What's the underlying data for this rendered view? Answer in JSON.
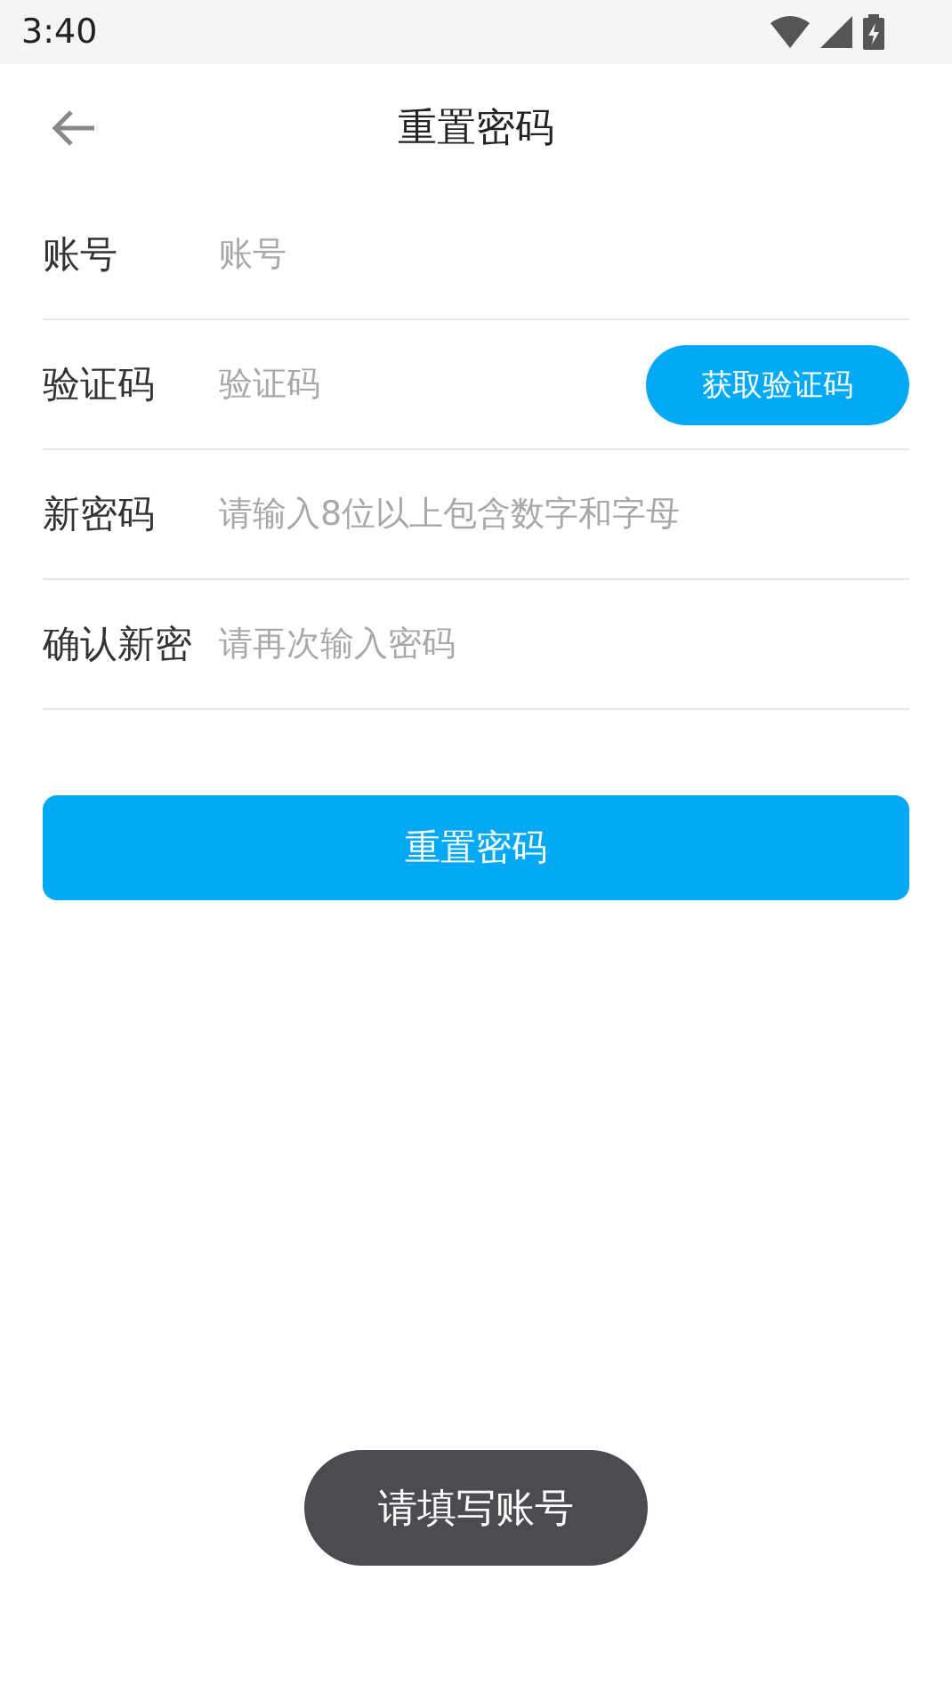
{
  "status_bar": {
    "time": "3:40"
  },
  "header": {
    "title": "重置密码"
  },
  "fields": [
    {
      "label": "账号",
      "placeholder": "账号"
    },
    {
      "label": "验证码",
      "placeholder": "验证码",
      "action": "获取验证码"
    },
    {
      "label": "新密码",
      "placeholder": "请输入8位以上包含数字和字母"
    },
    {
      "label": "确认新密",
      "placeholder": "请再次输入密码"
    }
  ],
  "submit": "重置密码",
  "toast": "请填写账号"
}
